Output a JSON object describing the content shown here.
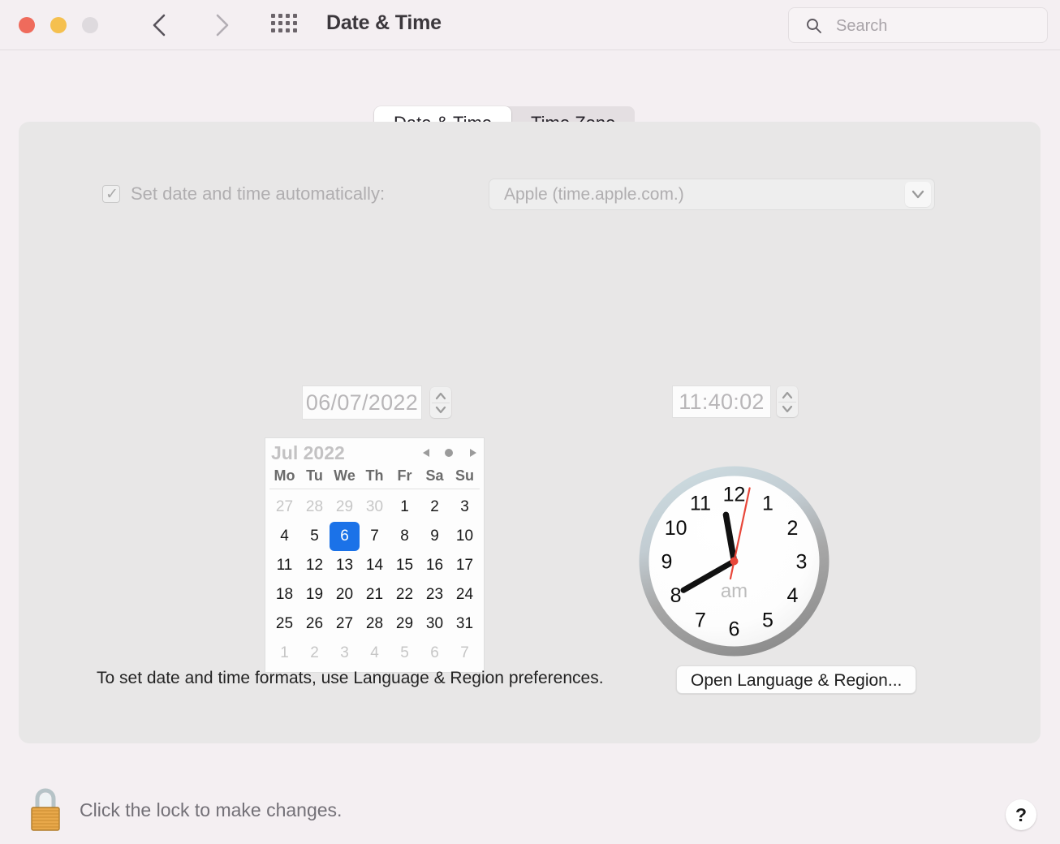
{
  "window": {
    "title": "Date & Time",
    "traffic_lights": [
      "close",
      "minimize",
      "maximize"
    ],
    "nav_back": "‹",
    "nav_forward": "›"
  },
  "search": {
    "placeholder": "Search",
    "value": ""
  },
  "tabs": [
    {
      "label": "Date & Time",
      "active": true
    },
    {
      "label": "Time Zone",
      "active": false
    }
  ],
  "auto_set": {
    "label": "Set date and time automatically:",
    "checked": true,
    "enabled": false,
    "check_glyph": "✓",
    "server": {
      "selected": "Apple (time.apple.com.)",
      "options": [
        "Apple (time.apple.com.)"
      ]
    }
  },
  "date_field": {
    "value": "06/07/2022",
    "stepper": "date-stepper"
  },
  "time_field": {
    "value": "11:40:02",
    "stepper": "time-stepper"
  },
  "calendar": {
    "title": "Jul 2022",
    "month": "Jul",
    "year": "2022",
    "prev_glyph": "◀",
    "today_glyph": "●",
    "next_glyph": "▶",
    "day_headers": [
      "Mo",
      "Tu",
      "We",
      "Th",
      "Fr",
      "Sa",
      "Su"
    ],
    "selected_day": 6,
    "weeks": [
      [
        {
          "d": "27",
          "other": true
        },
        {
          "d": "28",
          "other": true
        },
        {
          "d": "29",
          "other": true
        },
        {
          "d": "30",
          "other": true
        },
        {
          "d": "1",
          "other": false
        },
        {
          "d": "2",
          "other": false
        },
        {
          "d": "3",
          "other": false
        }
      ],
      [
        {
          "d": "4",
          "other": false
        },
        {
          "d": "5",
          "other": false
        },
        {
          "d": "6",
          "other": false,
          "selected": true
        },
        {
          "d": "7",
          "other": false
        },
        {
          "d": "8",
          "other": false
        },
        {
          "d": "9",
          "other": false
        },
        {
          "d": "10",
          "other": false
        }
      ],
      [
        {
          "d": "11",
          "other": false
        },
        {
          "d": "12",
          "other": false
        },
        {
          "d": "13",
          "other": false
        },
        {
          "d": "14",
          "other": false
        },
        {
          "d": "15",
          "other": false
        },
        {
          "d": "16",
          "other": false
        },
        {
          "d": "17",
          "other": false
        }
      ],
      [
        {
          "d": "18",
          "other": false
        },
        {
          "d": "19",
          "other": false
        },
        {
          "d": "20",
          "other": false
        },
        {
          "d": "21",
          "other": false
        },
        {
          "d": "22",
          "other": false
        },
        {
          "d": "23",
          "other": false
        },
        {
          "d": "24",
          "other": false
        }
      ],
      [
        {
          "d": "25",
          "other": false
        },
        {
          "d": "26",
          "other": false
        },
        {
          "d": "27",
          "other": false
        },
        {
          "d": "28",
          "other": false
        },
        {
          "d": "29",
          "other": false
        },
        {
          "d": "30",
          "other": false
        },
        {
          "d": "31",
          "other": false
        }
      ],
      [
        {
          "d": "1",
          "other": true
        },
        {
          "d": "2",
          "other": true
        },
        {
          "d": "3",
          "other": true
        },
        {
          "d": "4",
          "other": true
        },
        {
          "d": "5",
          "other": true
        },
        {
          "d": "6",
          "other": true
        },
        {
          "d": "7",
          "other": true
        }
      ]
    ]
  },
  "clock": {
    "meridiem": "am",
    "hour": 11,
    "minute": 40,
    "second": 2,
    "numerals": [
      "12",
      "1",
      "2",
      "3",
      "4",
      "5",
      "6",
      "7",
      "8",
      "9",
      "10",
      "11"
    ],
    "second_hand_color": "#e8473a",
    "hand_color": "#111111"
  },
  "footer_panel": {
    "format_note": "To set date and time formats, use Language & Region preferences.",
    "open_language_button": "Open Language & Region..."
  },
  "footer": {
    "lock_text": "Click the lock to make changes.",
    "lock_state": "locked",
    "help_label": "?"
  },
  "colors": {
    "window_background": "#f4eff2",
    "panel_background": "#e8e7e7",
    "accent_selection": "#1b72e8",
    "close_button": "#ef6b5c",
    "minimize_button": "#f5c04f",
    "maximize_button": "#dedade",
    "second_hand": "#e8473a"
  }
}
